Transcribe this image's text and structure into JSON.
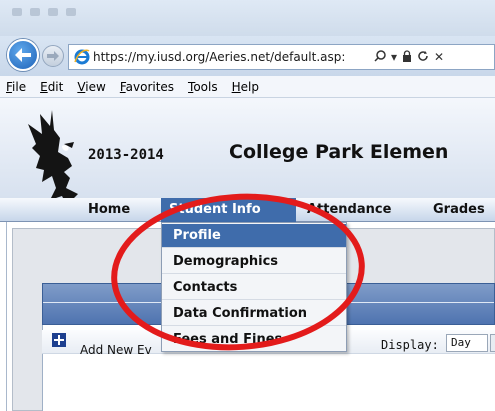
{
  "browser": {
    "url": "https://my.iusd.org/Aeries.net/default.asp:",
    "menu": [
      "File",
      "Edit",
      "View",
      "Favorites",
      "Tools",
      "Help"
    ]
  },
  "site": {
    "school_year": "2013-2014",
    "school_name": "College Park Elemen"
  },
  "tabs": [
    "Home",
    "Student Info",
    "Attendance",
    "Grades"
  ],
  "dropdown": {
    "items": [
      "Profile",
      "Demographics",
      "Contacts",
      "Data Confirmation",
      "Fees and Fines"
    ],
    "selected_index": 0
  },
  "toolbar": {
    "add_label": "Add New Ev",
    "display_label": "Display:",
    "display_value": "Day"
  },
  "colors": {
    "accent": "#3f6cab",
    "annotation": "#e31b1b"
  },
  "icons": {
    "back": "back-arrow-icon",
    "forward": "forward-arrow-icon",
    "browser": "internet-explorer-icon",
    "search": "search-icon",
    "lock": "lock-icon",
    "refresh": "refresh-icon",
    "close": "close-icon",
    "add": "add-plus-icon"
  }
}
